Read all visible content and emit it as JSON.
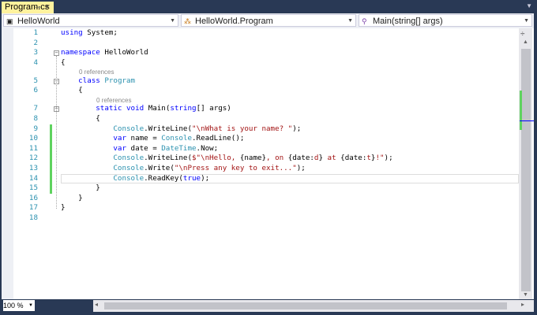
{
  "tab": {
    "title": "Program.cs",
    "pin_icon": "pin-icon",
    "close_icon": "×"
  },
  "nav": {
    "project": "HelloWorld",
    "class": "HelloWorld.Program",
    "member": "Main(string[] args)"
  },
  "codelens": {
    "references": "0 references"
  },
  "lines": [
    {
      "n": "1",
      "tokens": [
        [
          "kw",
          "using"
        ],
        [
          "pl",
          " System;"
        ]
      ]
    },
    {
      "n": "2",
      "tokens": []
    },
    {
      "n": "3",
      "tokens": [
        [
          "kw",
          "namespace"
        ],
        [
          "pl",
          " HelloWorld"
        ]
      ]
    },
    {
      "n": "4",
      "tokens": [
        [
          "pl",
          "{"
        ]
      ]
    },
    {
      "n": "5",
      "tokens": [
        [
          "pl",
          "    "
        ],
        [
          "kw",
          "class"
        ],
        [
          "pl",
          " "
        ],
        [
          "ty",
          "Program"
        ]
      ]
    },
    {
      "n": "6",
      "tokens": [
        [
          "pl",
          "    {"
        ]
      ]
    },
    {
      "n": "7",
      "tokens": [
        [
          "pl",
          "        "
        ],
        [
          "kw",
          "static"
        ],
        [
          "pl",
          " "
        ],
        [
          "kw",
          "void"
        ],
        [
          "pl",
          " Main("
        ],
        [
          "kw",
          "string"
        ],
        [
          "pl",
          "[] args)"
        ]
      ]
    },
    {
      "n": "8",
      "tokens": [
        [
          "pl",
          "        {"
        ]
      ]
    },
    {
      "n": "9",
      "tokens": [
        [
          "pl",
          "            "
        ],
        [
          "ty",
          "Console"
        ],
        [
          "pl",
          ".WriteLine("
        ],
        [
          "st",
          "\"\\nWhat is your name? \""
        ],
        [
          "pl",
          ");"
        ]
      ]
    },
    {
      "n": "10",
      "tokens": [
        [
          "pl",
          "            "
        ],
        [
          "kw",
          "var"
        ],
        [
          "pl",
          " name = "
        ],
        [
          "ty",
          "Console"
        ],
        [
          "pl",
          ".ReadLine();"
        ]
      ]
    },
    {
      "n": "11",
      "tokens": [
        [
          "pl",
          "            "
        ],
        [
          "kw",
          "var"
        ],
        [
          "pl",
          " date = "
        ],
        [
          "ty",
          "DateTime"
        ],
        [
          "pl",
          ".Now;"
        ]
      ]
    },
    {
      "n": "12",
      "tokens": [
        [
          "pl",
          "            "
        ],
        [
          "ty",
          "Console"
        ],
        [
          "pl",
          ".WriteLine("
        ],
        [
          "st",
          "$\"\\nHello, "
        ],
        [
          "pl",
          "{name}"
        ],
        [
          "st",
          ", on "
        ],
        [
          "pl",
          "{date:"
        ],
        [
          "st",
          "d"
        ],
        [
          "pl",
          "}"
        ],
        [
          "st",
          " at "
        ],
        [
          "pl",
          "{date:"
        ],
        [
          "st",
          "t"
        ],
        [
          "pl",
          "}"
        ],
        [
          "st",
          "!\""
        ],
        [
          "pl",
          ");"
        ]
      ]
    },
    {
      "n": "13",
      "tokens": [
        [
          "pl",
          "            "
        ],
        [
          "ty",
          "Console"
        ],
        [
          "pl",
          ".Write("
        ],
        [
          "st",
          "\"\\nPress any key to exit...\""
        ],
        [
          "pl",
          ");"
        ]
      ]
    },
    {
      "n": "14",
      "tokens": [
        [
          "pl",
          "            "
        ],
        [
          "ty",
          "Console"
        ],
        [
          "pl",
          ".ReadKey("
        ],
        [
          "kw",
          "true"
        ],
        [
          "pl",
          ");"
        ]
      ]
    },
    {
      "n": "15",
      "tokens": [
        [
          "pl",
          "        }"
        ]
      ]
    },
    {
      "n": "16",
      "tokens": [
        [
          "pl",
          "    }"
        ]
      ]
    },
    {
      "n": "17",
      "tokens": [
        [
          "pl",
          "}"
        ]
      ]
    },
    {
      "n": "18",
      "tokens": []
    }
  ],
  "status": {
    "zoom": "100 %"
  },
  "colors": {
    "tab": "#fff29d",
    "frame": "#293955",
    "change": "#5fd35f"
  }
}
